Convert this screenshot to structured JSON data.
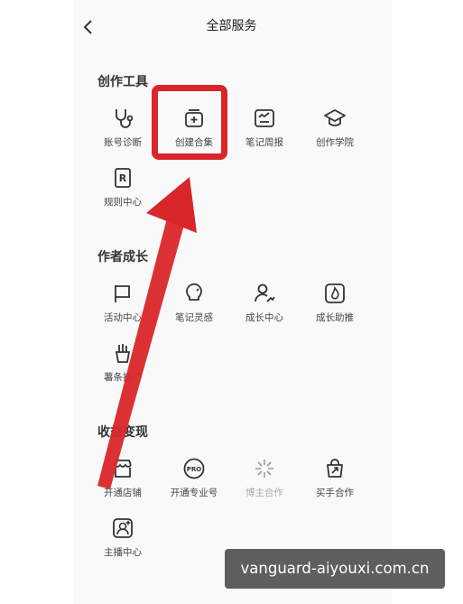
{
  "header": {
    "title": "全部服务",
    "back_icon": "chevron-left-icon"
  },
  "sections": {
    "creation_tools": {
      "title": "创作工具",
      "items": [
        {
          "label": "账号诊断",
          "icon": "stethoscope-icon"
        },
        {
          "label": "创建合集",
          "icon": "collection-add-icon"
        },
        {
          "label": "笔记周报",
          "icon": "report-chart-icon"
        },
        {
          "label": "创作学院",
          "icon": "graduation-cap-icon"
        },
        {
          "label": "规则中心",
          "icon": "rules-book-icon"
        }
      ]
    },
    "author_growth": {
      "title": "作者成长",
      "items": [
        {
          "label": "活动中心",
          "icon": "flag-icon"
        },
        {
          "label": "笔记灵感",
          "icon": "lightbulb-icon"
        },
        {
          "label": "成长中心",
          "icon": "user-growth-icon"
        },
        {
          "label": "成长助推",
          "icon": "flame-boost-icon"
        },
        {
          "label": "薯条推广",
          "icon": "fries-promo-icon"
        }
      ]
    },
    "monetization": {
      "title": "收益变现",
      "items": [
        {
          "label": "开通店铺",
          "icon": "store-icon"
        },
        {
          "label": "开通专业号",
          "icon": "pro-badge-icon"
        },
        {
          "label": "博主合作",
          "icon": "sparkle-collab-icon"
        },
        {
          "label": "买手合作",
          "icon": "shopping-bag-icon"
        },
        {
          "label": "主播中心",
          "icon": "anchor-portrait-icon"
        }
      ]
    }
  },
  "annotation": {
    "highlight_color": "#d9262a",
    "target": "创建合集"
  },
  "watermark": "vanguard-aiyouxi.com.cn"
}
